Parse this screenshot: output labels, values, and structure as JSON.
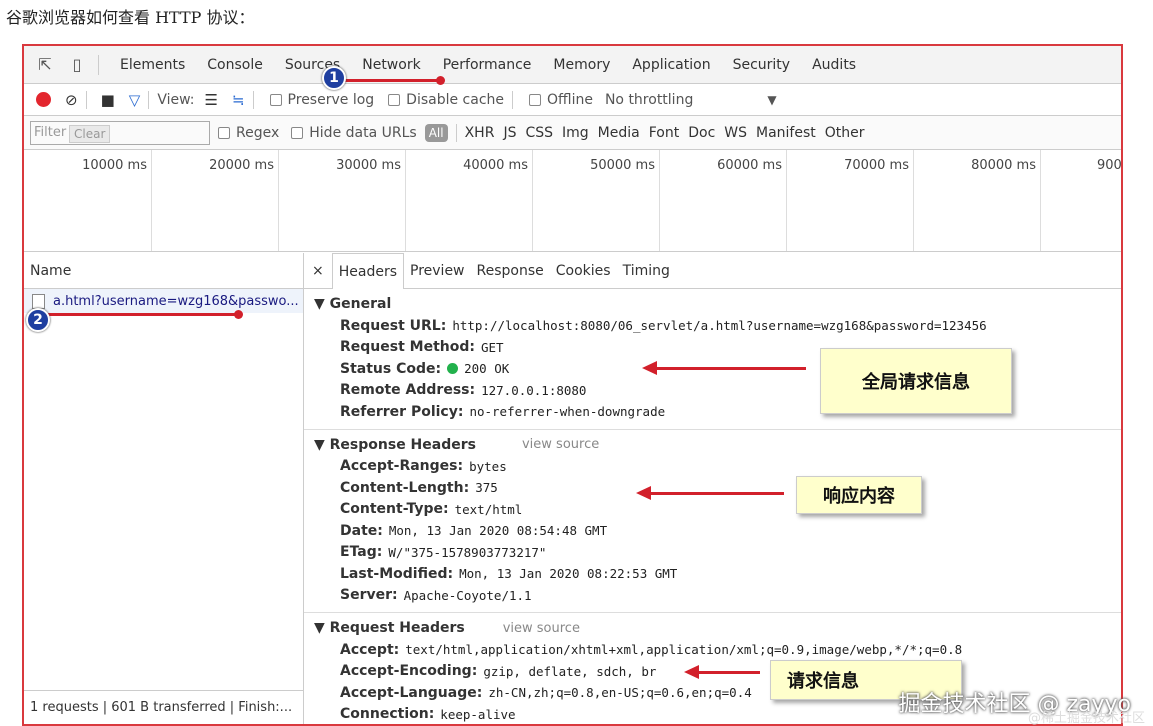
{
  "caption": "谷歌浏览器如何查看 HTTP 协议：",
  "devtools": {
    "tabs": [
      "Elements",
      "Console",
      "Sources",
      "Network",
      "Performance",
      "Memory",
      "Application",
      "Security",
      "Audits"
    ]
  },
  "toolbar": {
    "view_label": "View:",
    "preserve_log": "Preserve log",
    "disable_cache": "Disable cache",
    "offline": "Offline",
    "throttling": "No throttling"
  },
  "filterbar": {
    "filter_placeholder": "Filter",
    "clear_tooltip": "Clear",
    "regex": "Regex",
    "hide_data_urls": "Hide data URLs",
    "all": "All",
    "types": [
      "XHR",
      "JS",
      "CSS",
      "Img",
      "Media",
      "Font",
      "Doc",
      "WS",
      "Manifest",
      "Other"
    ]
  },
  "timeline": {
    "ticks": [
      "10000 ms",
      "20000 ms",
      "30000 ms",
      "40000 ms",
      "50000 ms",
      "60000 ms",
      "70000 ms",
      "80000 ms",
      "900"
    ]
  },
  "requests": {
    "header": "Name",
    "items": [
      "a.html?username=wzg168&passwo..."
    ],
    "status": "1 requests | 601 B transferred | Finish:..."
  },
  "detail": {
    "close": "×",
    "tabs": [
      "Headers",
      "Preview",
      "Response",
      "Cookies",
      "Timing"
    ],
    "general": {
      "title": "▼ General",
      "rows": [
        {
          "k": "Request URL:",
          "v": "http://localhost:8080/06_servlet/a.html?username=wzg168&password=123456"
        },
        {
          "k": "Request Method:",
          "v": "GET"
        },
        {
          "k": "Status Code:",
          "v": "200 OK"
        },
        {
          "k": "Remote Address:",
          "v": "127.0.0.1:8080"
        },
        {
          "k": "Referrer Policy:",
          "v": "no-referrer-when-downgrade"
        }
      ]
    },
    "response_headers": {
      "title": "▼ Response Headers",
      "view_source": "view source",
      "rows": [
        {
          "k": "Accept-Ranges:",
          "v": "bytes"
        },
        {
          "k": "Content-Length:",
          "v": "375"
        },
        {
          "k": "Content-Type:",
          "v": "text/html"
        },
        {
          "k": "Date:",
          "v": "Mon, 13 Jan 2020 08:54:48 GMT"
        },
        {
          "k": "ETag:",
          "v": "W/\"375-1578903773217\""
        },
        {
          "k": "Last-Modified:",
          "v": "Mon, 13 Jan 2020 08:22:53 GMT"
        },
        {
          "k": "Server:",
          "v": "Apache-Coyote/1.1"
        }
      ]
    },
    "request_headers": {
      "title": "▼ Request Headers",
      "view_source": "view source",
      "rows": [
        {
          "k": "Accept:",
          "v": "text/html,application/xhtml+xml,application/xml;q=0.9,image/webp,*/*;q=0.8"
        },
        {
          "k": "Accept-Encoding:",
          "v": "gzip, deflate, sdch, br"
        },
        {
          "k": "Accept-Language:",
          "v": "zh-CN,zh;q=0.8,en-US;q=0.6,en;q=0.4"
        },
        {
          "k": "Connection:",
          "v": "keep-alive"
        }
      ]
    }
  },
  "annotations": {
    "badge1": "1",
    "badge2": "2",
    "note_general": "全局请求信息",
    "note_response": "响应内容",
    "note_request": "请求信息"
  },
  "watermark": "掘金技术社区 @ zayyo",
  "watermark2": "@稀土掘金技术社区"
}
